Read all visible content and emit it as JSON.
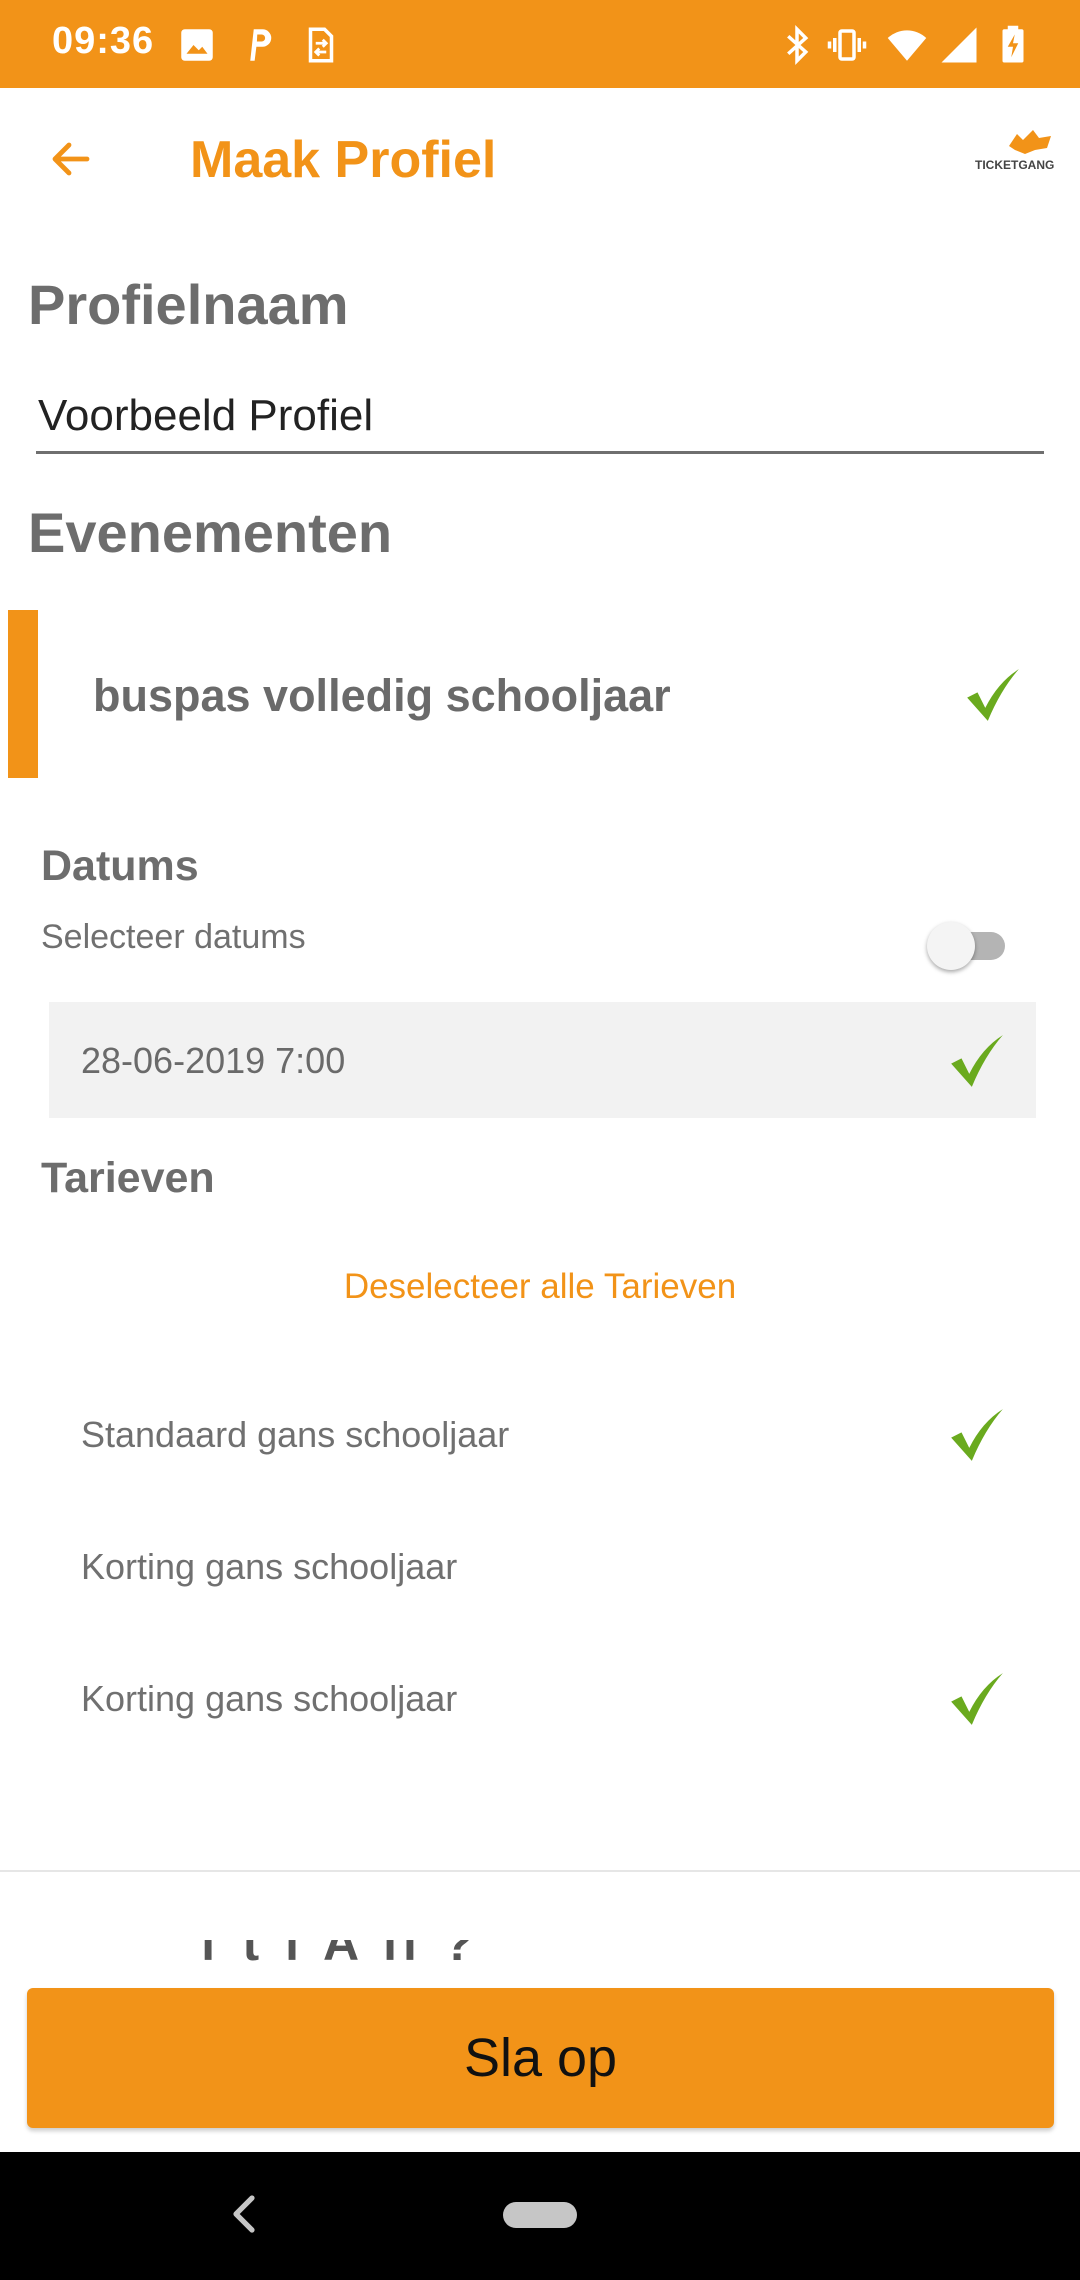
{
  "status_bar": {
    "time": "09:36",
    "left_icons": [
      "image-icon",
      "parking-icon",
      "transfer-icon"
    ],
    "right_icons": [
      "bluetooth-icon",
      "vibrate-icon",
      "wifi-icon",
      "signal-icon",
      "battery-charging-icon"
    ]
  },
  "app_bar": {
    "title": "Maak Profiel",
    "logo_text": "TICKETGANG"
  },
  "profile": {
    "section_title": "Profielnaam",
    "name_value": "Voorbeeld Profiel"
  },
  "events": {
    "section_title": "Evenementen",
    "items": [
      {
        "name": "buspas volledig schooljaar",
        "selected": true
      }
    ]
  },
  "dates": {
    "title": "Datums",
    "select_label": "Selecteer datums",
    "toggle_on": false,
    "items": [
      {
        "label": "28-06-2019 7:00",
        "selected": true
      }
    ]
  },
  "tariffs": {
    "title": "Tarieven",
    "deselect_all": "Deselecteer alle Tarieven",
    "items": [
      {
        "label": "Standaard gans schooljaar",
        "selected": true
      },
      {
        "label": "Korting gans schooljaar",
        "selected": false
      },
      {
        "label": "Korting gans schooljaar",
        "selected": true
      }
    ]
  },
  "footer": {
    "partial_text": "f    t   l A          ll       ?",
    "save_label": "Sla op"
  },
  "colors": {
    "accent": "#f29318",
    "check": "#6aaa1e",
    "nav_bar": "#000000"
  }
}
